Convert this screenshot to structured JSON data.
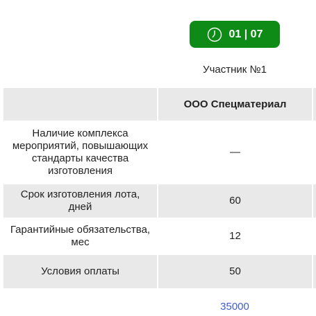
{
  "timer": {
    "label": "01 | 07",
    "icon": "clock-icon",
    "color": "#0e8a16"
  },
  "participant": "Участник №1",
  "table": {
    "company": "ООО Спецматериал",
    "rows": [
      {
        "label": "Наличие комплекса мероприятий, повышающих стандарты качества изготовления",
        "value": "—"
      },
      {
        "label": "Срок изготовления лота, дней",
        "value": "60"
      },
      {
        "label": "Гарантийные обязательства, мес",
        "value": "12"
      },
      {
        "label": "Условия оплаты",
        "value": "50"
      }
    ]
  },
  "price": {
    "value": "35000",
    "color": "#3f5dc9"
  }
}
